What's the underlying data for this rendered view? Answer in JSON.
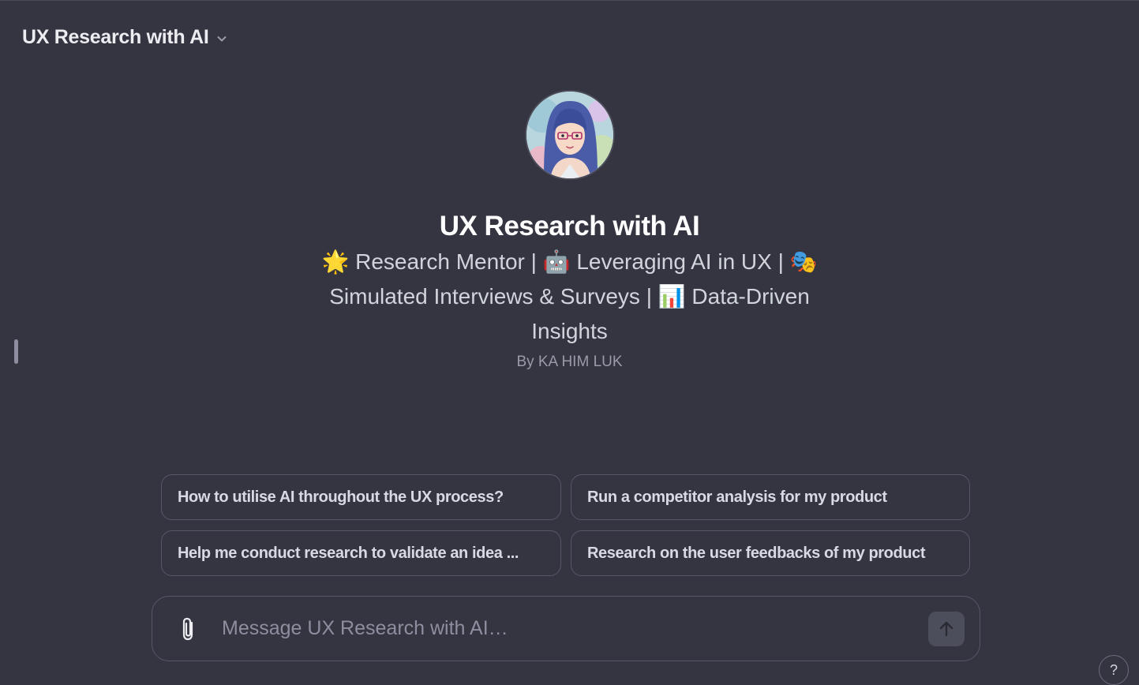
{
  "header": {
    "model_title": "UX Research with AI"
  },
  "hero": {
    "name": "UX Research with AI",
    "description": "🌟 Research Mentor | 🤖 Leveraging AI in UX | 🎭 Simulated Interviews & Surveys | 📊 Data-Driven Insights",
    "author": "By KA HIM LUK"
  },
  "prompts": [
    "How to utilise AI throughout the UX process?",
    "Run a competitor analysis for my product",
    "Help me conduct research to validate an idea ...",
    "Research on the user feedbacks of my product"
  ],
  "composer": {
    "placeholder": "Message UX Research with AI…"
  },
  "help": {
    "label": "?"
  },
  "icons": {
    "chevron": "chevron-down-icon",
    "attach": "paperclip-icon",
    "send": "arrow-up-icon"
  }
}
